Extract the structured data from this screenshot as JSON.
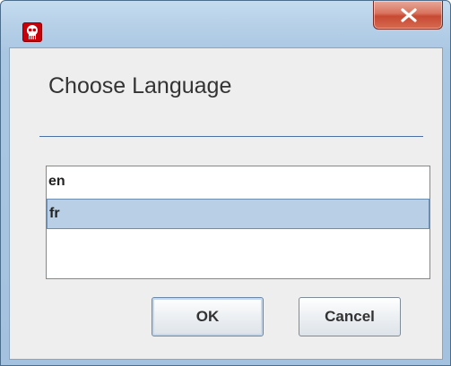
{
  "window": {
    "icon": "app-logo-icon",
    "close_icon": "close-icon",
    "accent_color": "#c74a33"
  },
  "dialog": {
    "heading": "Choose Language",
    "languages": [
      {
        "label": "en",
        "selected": false
      },
      {
        "label": "fr",
        "selected": true
      }
    ],
    "ok_label": "OK",
    "cancel_label": "Cancel"
  }
}
